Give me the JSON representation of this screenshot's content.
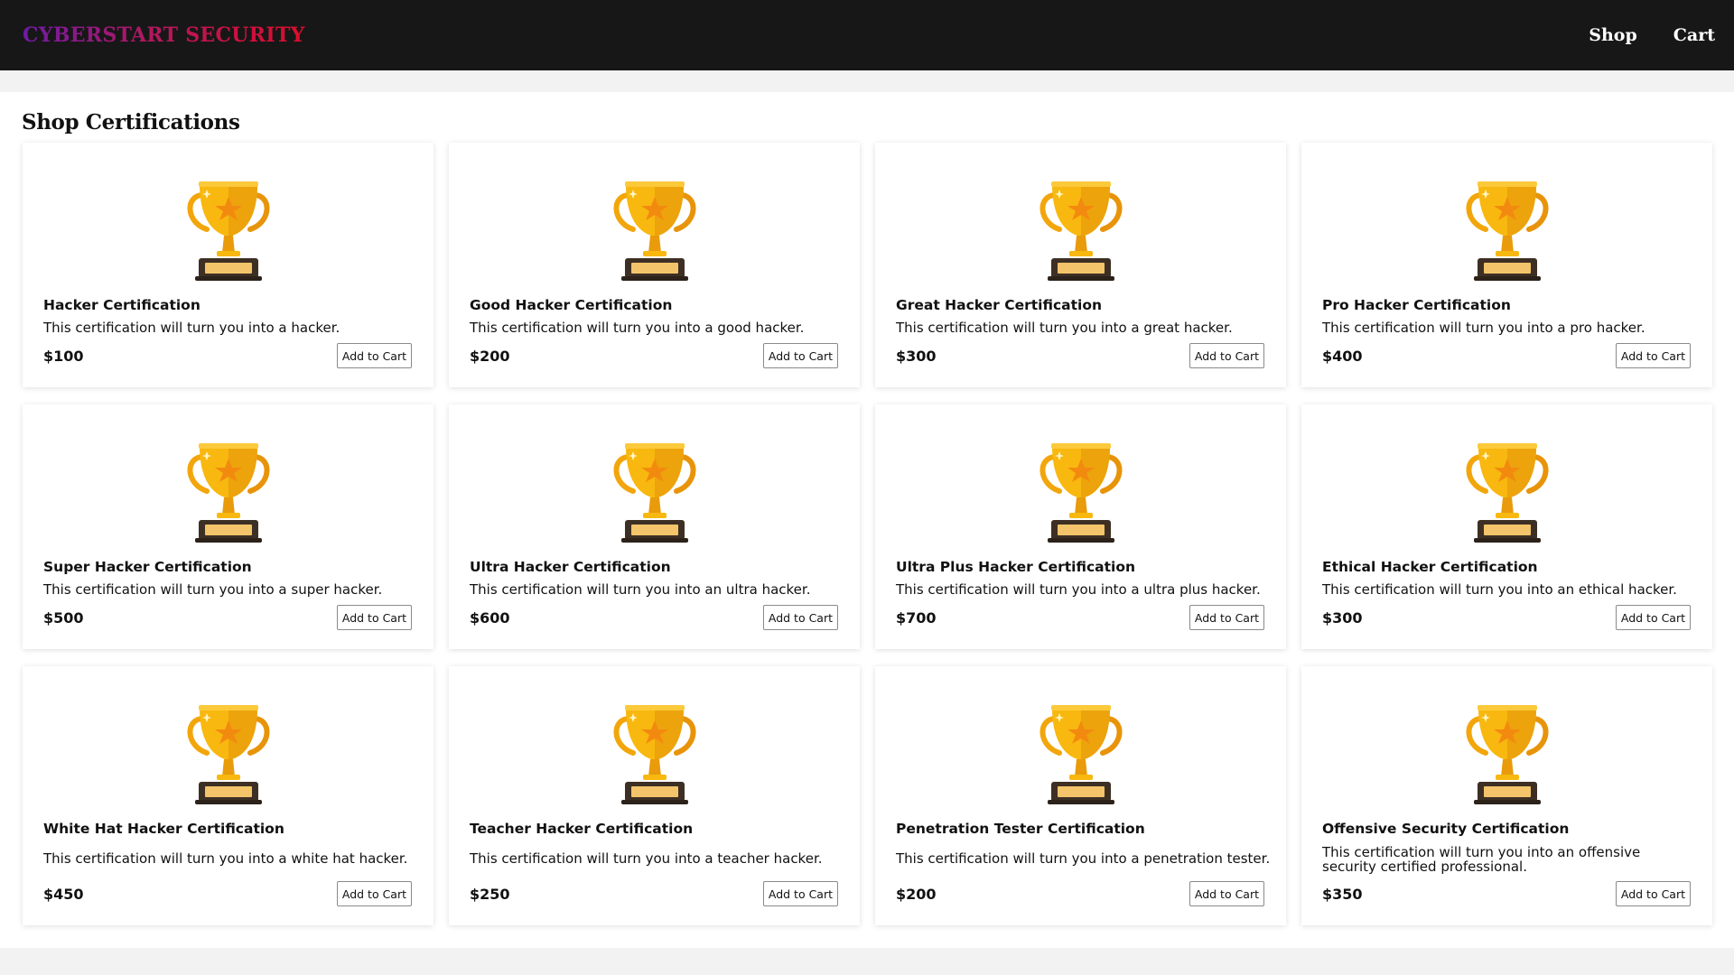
{
  "header": {
    "brand": "CYBERSTART SECURITY",
    "nav": [
      {
        "label": "Shop"
      },
      {
        "label": "Cart"
      }
    ]
  },
  "main": {
    "title": "Shop Certifications",
    "add_to_cart_label": "Add to Cart",
    "icon": "trophy-icon",
    "products": [
      {
        "name": "Hacker Certification",
        "description": "This certification will turn you into a hacker.",
        "price": "$100"
      },
      {
        "name": "Good Hacker Certification",
        "description": "This certification will turn you into a good hacker.",
        "price": "$200"
      },
      {
        "name": "Great Hacker Certification",
        "description": "This certification will turn you into a great hacker.",
        "price": "$300"
      },
      {
        "name": "Pro Hacker Certification",
        "description": "This certification will turn you into a pro hacker.",
        "price": "$400"
      },
      {
        "name": "Super Hacker Certification",
        "description": "This certification will turn you into a super hacker.",
        "price": "$500"
      },
      {
        "name": "Ultra Hacker Certification",
        "description": "This certification will turn you into an ultra hacker.",
        "price": "$600"
      },
      {
        "name": "Ultra Plus Hacker Certification",
        "description": "This certification will turn you into a ultra plus hacker.",
        "price": "$700"
      },
      {
        "name": "Ethical Hacker Certification",
        "description": "This certification will turn you into an ethical hacker.",
        "price": "$300"
      },
      {
        "name": "White Hat Hacker Certification",
        "description": "This certification will turn you into a white hat hacker.",
        "price": "$450"
      },
      {
        "name": "Teacher Hacker Certification",
        "description": "This certification will turn you into a teacher hacker.",
        "price": "$250"
      },
      {
        "name": "Penetration Tester Certification",
        "description": "This certification will turn you into a penetration tester.",
        "price": "$200"
      },
      {
        "name": "Offensive Security Certification",
        "description": "This certification will turn you into an offensive security certified professional.",
        "price": "$350"
      }
    ]
  },
  "colors": {
    "navbar": "#171717",
    "brand_gradient_start": "#6f1aa6",
    "brand_gradient_end": "#dd0d2a",
    "trophy_gold": "#f6b40e",
    "trophy_star": "#f48b0f"
  }
}
